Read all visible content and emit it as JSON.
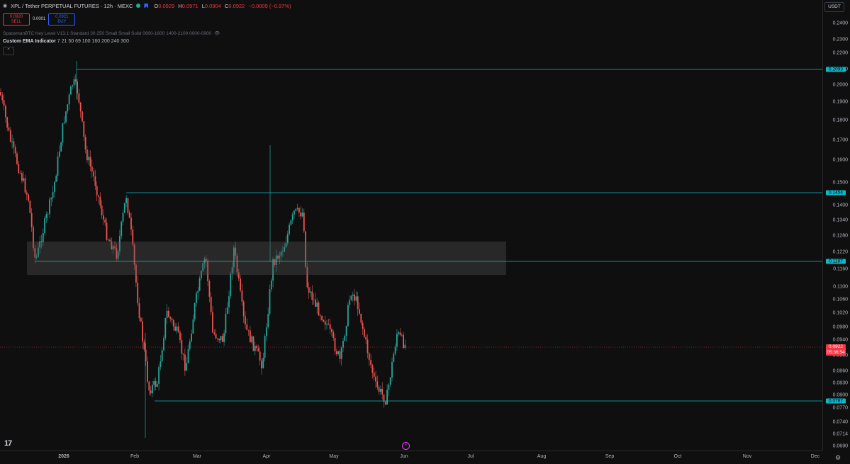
{
  "symbol": {
    "title": "XPL / Tether PERPETUAL FUTURES · 12h · MEXC",
    "ohlc": [
      {
        "k": "O",
        "v": "0.0929"
      },
      {
        "k": "H",
        "v": "0.0971"
      },
      {
        "k": "L",
        "v": "0.0904"
      },
      {
        "k": "C",
        "v": "0.0922"
      }
    ],
    "change": "−0.0009 (−0.97%)"
  },
  "trade": {
    "sell_price": "0.0920",
    "sell_label": "SELL",
    "spread": "0.0001",
    "buy_price": "0.0921",
    "buy_label": "BUY"
  },
  "indicators": {
    "key_level": "SpacemanBTC Key Level V13.1 Standard 30 250 Small Small Solid 0800-1600 1400-2100 0000-0900",
    "ema_name": "Custom EMA Indicator",
    "ema_values": "7 21 50 69 100 160 200 240 300"
  },
  "currency_button": "USDT",
  "price_axis_ticks": [
    "0.2400",
    "0.2300",
    "0.2200",
    "0.2100",
    "0.2000",
    "0.1900",
    "0.1800",
    "0.1700",
    "0.1600",
    "0.1500",
    "0.1400",
    "0.1340",
    "0.1280",
    "0.1220",
    "0.1160",
    "0.1100",
    "0.1060",
    "0.1020",
    "0.0980",
    "0.0940",
    "0.0900",
    "0.0860",
    "0.0830",
    "0.0800",
    "0.0770",
    "0.0740",
    "0.0714",
    "0.0690"
  ],
  "time_axis_labels": [
    "2026",
    "Feb",
    "Mar",
    "Apr",
    "May",
    "Jun",
    "Jul",
    "Aug",
    "Sep",
    "Oct",
    "Nov",
    "Dec"
  ],
  "level_tags": [
    "0.2093",
    "0.1454",
    "0.1187",
    "0.0787"
  ],
  "current_price": {
    "price": "0.0922",
    "countdown": "05:36:54"
  },
  "colors": {
    "bull": "#26a69a",
    "bear": "#ef5350",
    "level": "#0fb7c9",
    "zone": "#3a3a3a",
    "last": "#f23645"
  },
  "icons": [
    "tradingview-logo-icon",
    "settings-gear-icon",
    "eye-icon",
    "chevron-up-icon",
    "event-icon"
  ]
}
